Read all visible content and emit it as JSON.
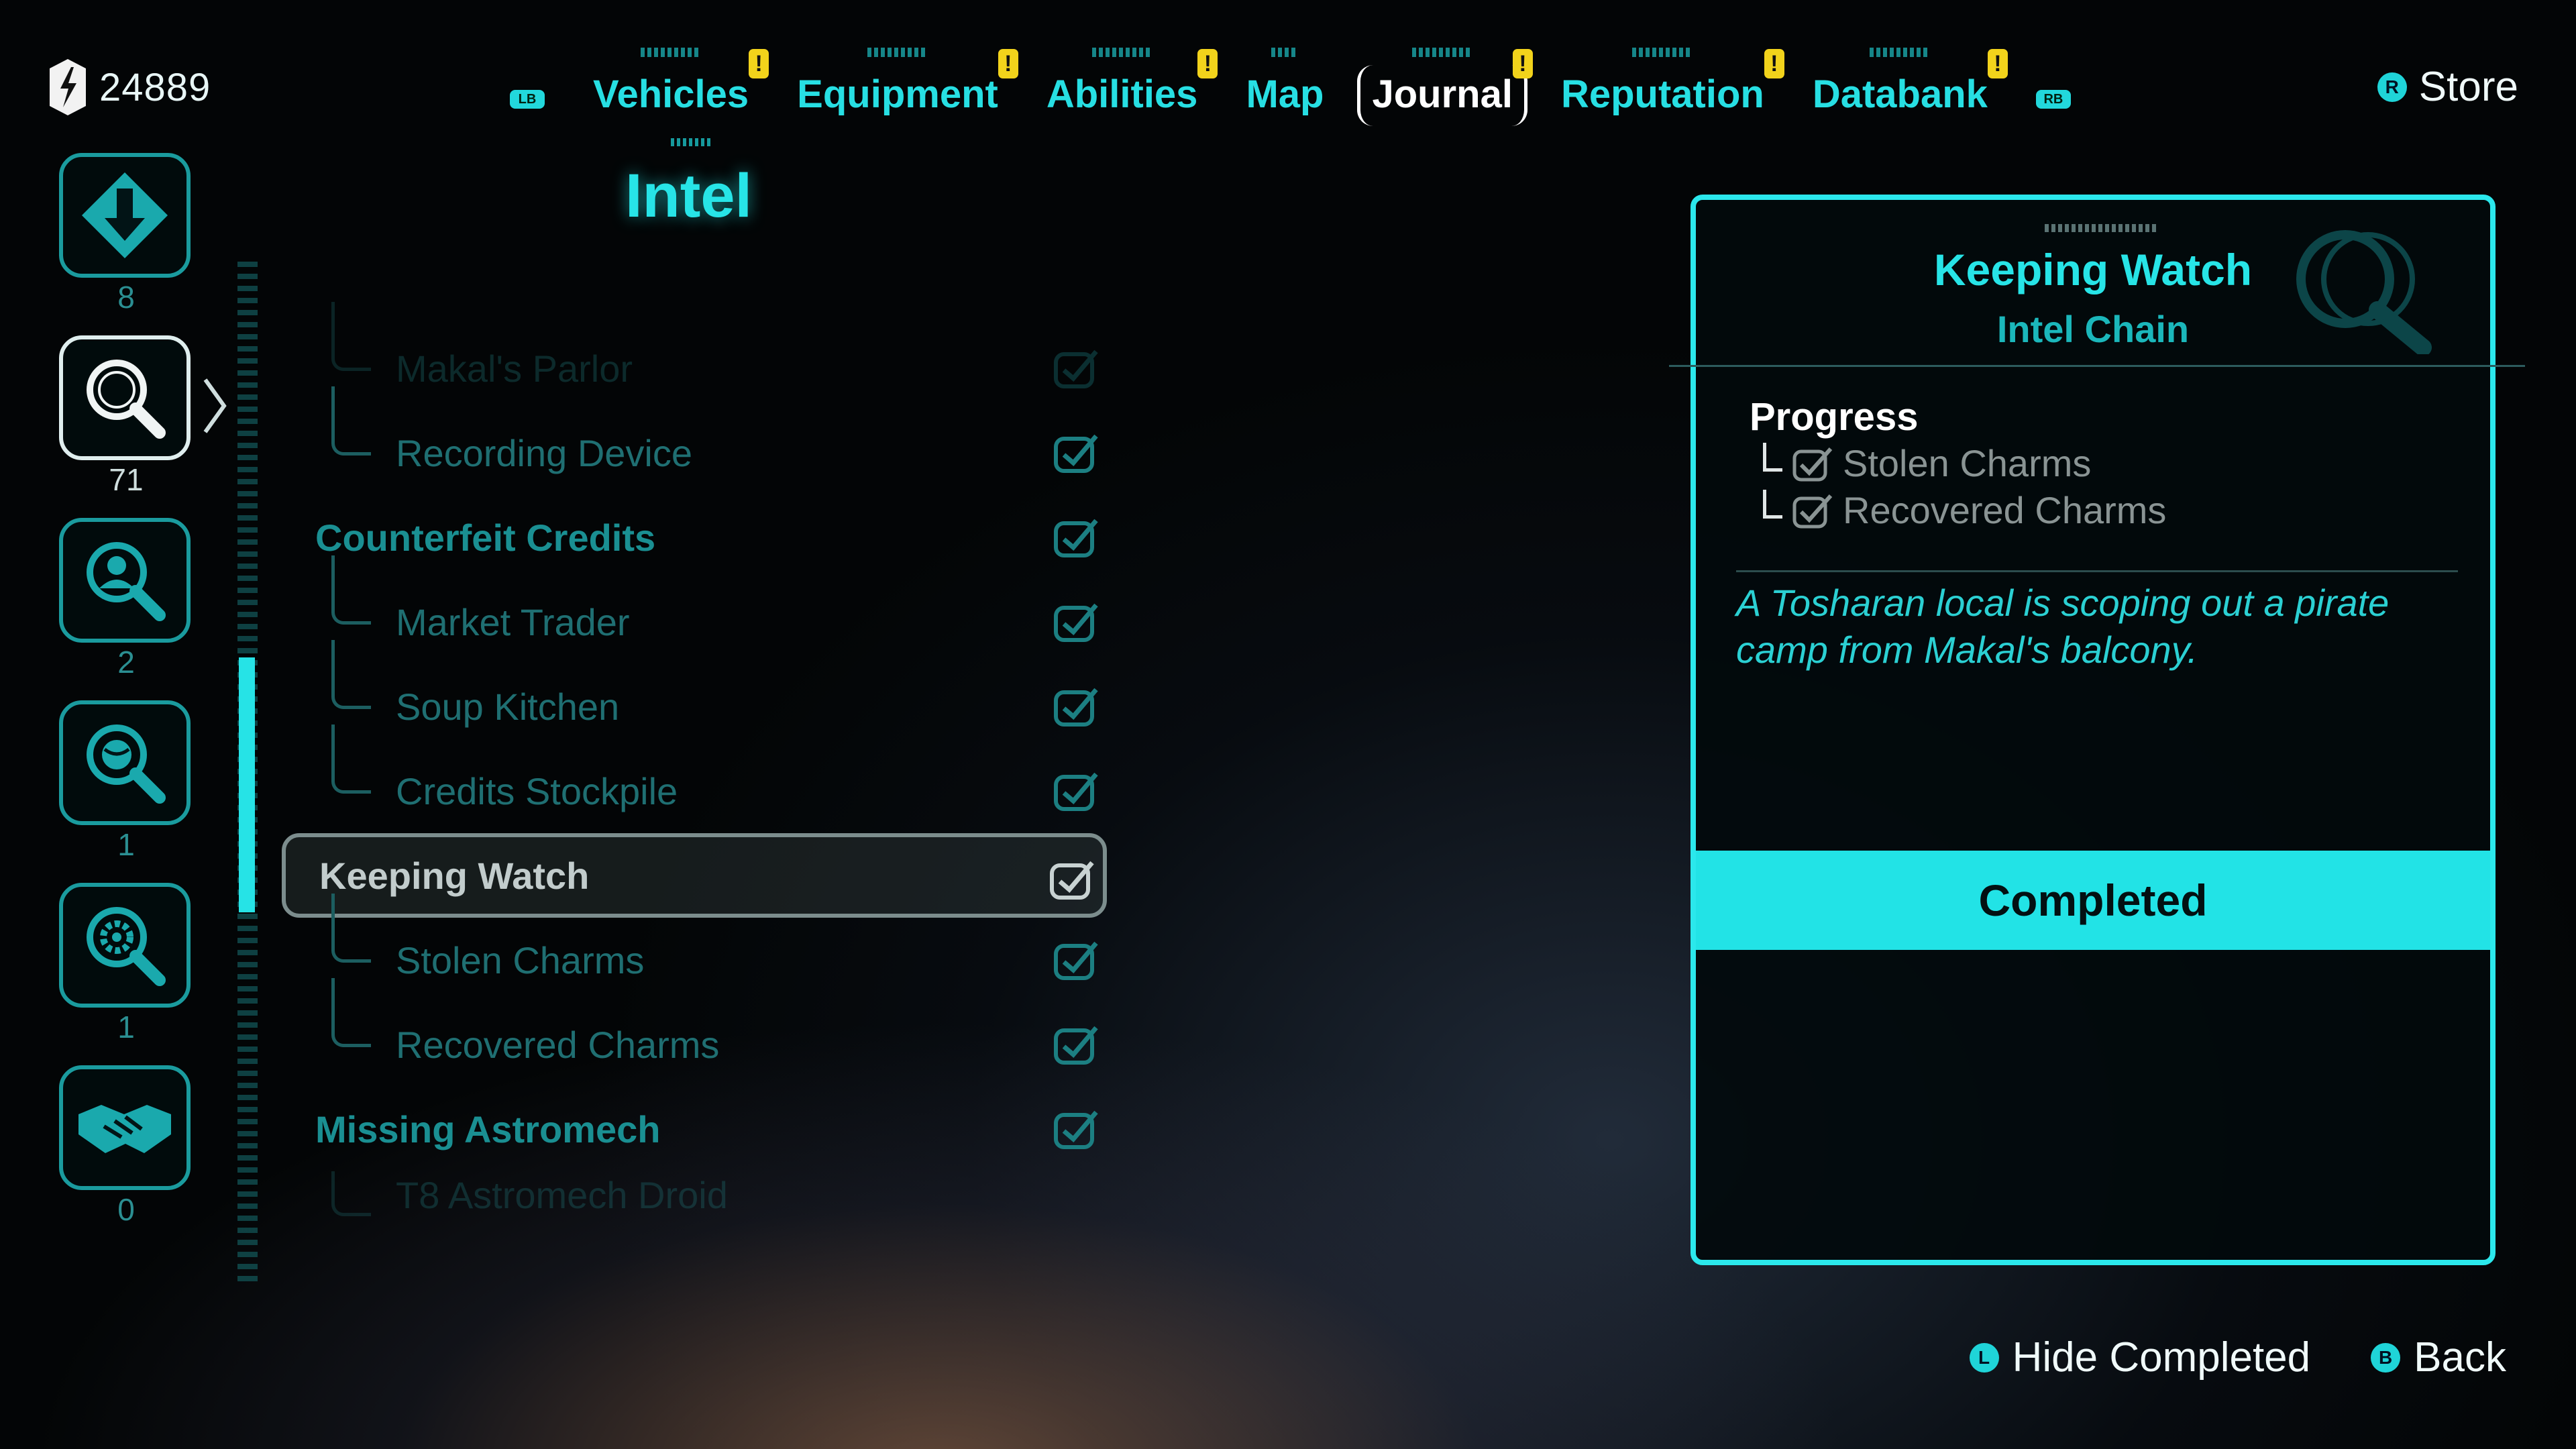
{
  "header": {
    "currency_value": "24889",
    "left_bumper": "LB",
    "right_bumper": "RB",
    "tabs": [
      {
        "label": "Vehicles",
        "alert": "!"
      },
      {
        "label": "Equipment",
        "alert": "!"
      },
      {
        "label": "Abilities",
        "alert": "!"
      },
      {
        "label": "Map",
        "alert": ""
      },
      {
        "label": "Journal",
        "alert": "!"
      },
      {
        "label": "Reputation",
        "alert": "!"
      },
      {
        "label": "Databank",
        "alert": "!"
      }
    ],
    "active_tab": "Journal",
    "store_button_glyph": "R",
    "store_label": "Store"
  },
  "categories": [
    {
      "icon": "diamond-arrow-icon",
      "count": "8"
    },
    {
      "icon": "magnifier-icon",
      "count": "71",
      "selected": true
    },
    {
      "icon": "magnifier-person-icon",
      "count": "2"
    },
    {
      "icon": "magnifier-globe-icon",
      "count": "1"
    },
    {
      "icon": "magnifier-gear-icon",
      "count": "1"
    },
    {
      "icon": "handshake-icon",
      "count": "0"
    }
  ],
  "list": {
    "title": "Intel",
    "rows": [
      {
        "label": "Makal's Parlor",
        "type": "child",
        "checked": true,
        "faded": true
      },
      {
        "label": "Recording Device",
        "type": "child",
        "checked": true
      },
      {
        "label": "Counterfeit Credits",
        "type": "parent",
        "checked": true
      },
      {
        "label": "Market Trader",
        "type": "child",
        "checked": true
      },
      {
        "label": "Soup Kitchen",
        "type": "child",
        "checked": true
      },
      {
        "label": "Credits Stockpile",
        "type": "child",
        "checked": true
      },
      {
        "label": "Keeping Watch",
        "type": "parent",
        "checked": true,
        "selected": true
      },
      {
        "label": "Stolen Charms",
        "type": "child",
        "checked": true
      },
      {
        "label": "Recovered Charms",
        "type": "child",
        "checked": true
      },
      {
        "label": "Missing Astromech",
        "type": "parent",
        "checked": true
      },
      {
        "label": "T8 Astromech Droid",
        "type": "child",
        "checked": true,
        "faded": true
      }
    ]
  },
  "detail": {
    "title": "Keeping Watch",
    "subtitle": "Intel Chain",
    "progress_title": "Progress",
    "progress": [
      "Stolen Charms",
      "Recovered Charms"
    ],
    "description": "A Tosharan local is scoping out a pirate camp from Makal's balcony.",
    "status": "Completed"
  },
  "hints": [
    {
      "glyph": "L",
      "label": "Hide Completed"
    },
    {
      "glyph": "B",
      "label": "Back"
    }
  ],
  "colors": {
    "accent": "#27e4e7",
    "alert": "#f2d31b",
    "panel_border": "#2be8ec"
  }
}
